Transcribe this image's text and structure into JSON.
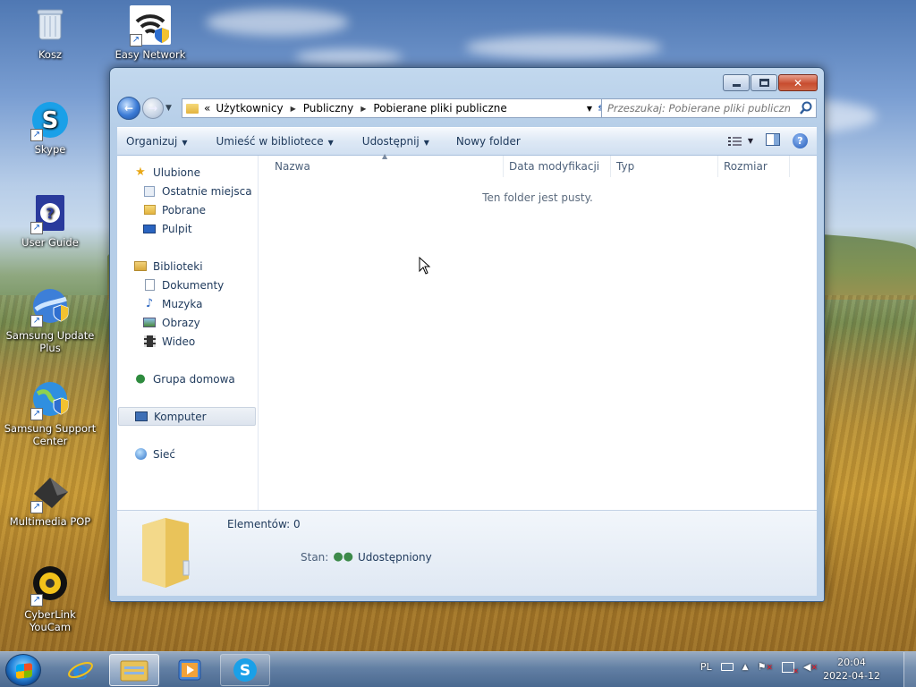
{
  "desktop": {
    "icons": [
      {
        "label": "Kosz",
        "icon": "recycle-bin-icon"
      },
      {
        "label": "Easy Network",
        "icon": "wifi-network-icon"
      },
      {
        "label": "Skype",
        "icon": "skype-icon"
      },
      {
        "label": "User Guide",
        "icon": "help-book-icon"
      },
      {
        "label": "Samsung Update Plus",
        "icon": "samsung-update-icon"
      },
      {
        "label": "Samsung Support Center",
        "icon": "globe-support-icon"
      },
      {
        "label": "Multimedia POP",
        "icon": "multimedia-icon"
      },
      {
        "label": "CyberLink YouCam",
        "icon": "webcam-icon"
      }
    ]
  },
  "window": {
    "address": {
      "overflow": "«",
      "segments": [
        "Użytkownicy",
        "Publiczny",
        "Pobierane pliki publiczne"
      ]
    },
    "search": {
      "placeholder": "Przeszukaj: Pobierane pliki publiczne"
    },
    "commands": {
      "organize": "Organizuj",
      "include_library": "Umieść w bibliotece",
      "share": "Udostępnij",
      "new_folder": "Nowy folder"
    },
    "nav": {
      "favorites": "Ulubione",
      "recent": "Ostatnie miejsca",
      "downloads": "Pobrane",
      "desktop": "Pulpit",
      "libraries": "Biblioteki",
      "documents": "Dokumenty",
      "music": "Muzyka",
      "pictures": "Obrazy",
      "videos": "Wideo",
      "homegroup": "Grupa domowa",
      "computer": "Komputer",
      "network": "Sieć"
    },
    "columns": {
      "name": "Nazwa",
      "modified": "Data modyfikacji",
      "type": "Typ",
      "size": "Rozmiar"
    },
    "empty_message": "Ten folder jest pusty.",
    "details": {
      "items": "Elementów: 0",
      "state_label": "Stan:",
      "state_value": "Udostępniony"
    }
  },
  "taskbar": {
    "language": "PL",
    "time": "20:04",
    "date": "2022-04-12",
    "pinned": [
      "internet-explorer-icon",
      "windows-explorer-icon",
      "media-player-icon",
      "skype-icon"
    ]
  },
  "colors": {
    "accent": "#1e395b",
    "window_frame": "#b6cee8",
    "close_button": "#c84d2f"
  }
}
